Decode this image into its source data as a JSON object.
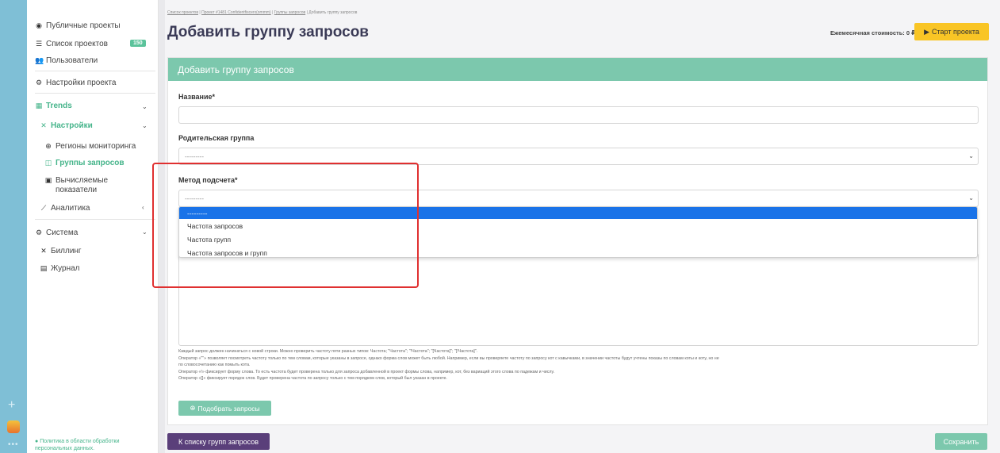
{
  "sidebar": {
    "public_projects": "Публичные проекты",
    "projects_list": "Список проектов",
    "projects_count": "150",
    "users": "Пользователи",
    "project_settings": "Настройки проекта",
    "trends": "Trends",
    "settings": "Настройки",
    "regions": "Регионы мониторинга",
    "query_groups": "Группы запросов",
    "computed_line1": "Вычисляемые",
    "computed_line2": "показатели",
    "analytics": "Аналитика",
    "system": "Система",
    "billing": "Биллинг",
    "journal": "Журнал",
    "privacy_line1": "Политика в области обработки",
    "privacy_line2": "персональных данных."
  },
  "breadcrumb": {
    "item1": "Список проектов",
    "item2": "Проект #1481 Confidentfiscerx(ommm)",
    "item3": "Группы запросов",
    "item4": "Добавить группу запросов",
    "sep": "|"
  },
  "header": {
    "title": "Добавить группу запросов",
    "cost": "Ежемесячная стоимость: 0 ₽",
    "start_button": "Старт проекта"
  },
  "form": {
    "card_title": "Добавить группу запросов",
    "name_label": "Название*",
    "name_value": "",
    "parent_label": "Родительская группа",
    "parent_value": "---------",
    "method_label": "Метод подсчета*",
    "method_value": "---------",
    "method_options": [
      "---------",
      "Частота запросов",
      "Частота групп",
      "Частота запросов и групп"
    ],
    "help_line1": "Каждый запрос должен начинаться с новой строки. Можно проверить частоту пяти разных типов: Частота; \"Частота\"; \"!Частота\"; \"[Частота]\"; \"[!Частота]\".",
    "help_line2": "Оператор «\"\"» позволяет посмотреть частоту только по тем словам, которые указаны в запросе, однако форма слов может быть любой. Например, если вы проверяете частоту по запросу кот с кавычками, в значении частоты будут учтены показы по словам коты и коту, но не",
    "help_line3": "по словосочетанию как помыть кота.",
    "help_line4": "Оператор «!» фиксирует форму слова. То есть частота будет проверена только для запроса добавленной в проект формы слова, например, кот, без вариаций этого слова по падежам и числу.",
    "help_line5": "Оператор «[]» фиксирует порядок слов. Будет проверена частота по запросу только с тем порядком слов, который был указан в проекте.",
    "pick_button": "Подобрать запросы"
  },
  "footer": {
    "back_button": "К списку групп запросов",
    "save_button": "Сохранить"
  },
  "colors": {
    "accent": "#7cc8ad",
    "title": "#3a3a56",
    "start": "#f9c525",
    "back": "#5a3f7a",
    "highlight": "#e03030",
    "selected": "#1a73e8"
  }
}
